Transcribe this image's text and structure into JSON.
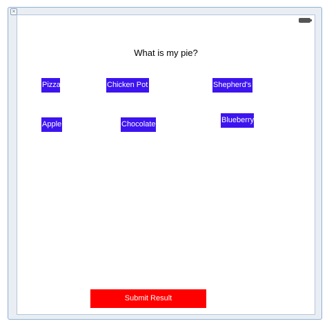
{
  "question": "What is my pie?",
  "choices": [
    {
      "label": "Pizza"
    },
    {
      "label": "Chicken Pot"
    },
    {
      "label": "Shepherd's"
    },
    {
      "label": "Apple"
    },
    {
      "label": "Chocolate"
    },
    {
      "label": "Blueberry"
    }
  ],
  "submit_label": "Submit Result",
  "colors": {
    "choice_bg": "#3d14f0",
    "submit_bg": "#ff0000",
    "frame_border": "#8fb0cf"
  }
}
